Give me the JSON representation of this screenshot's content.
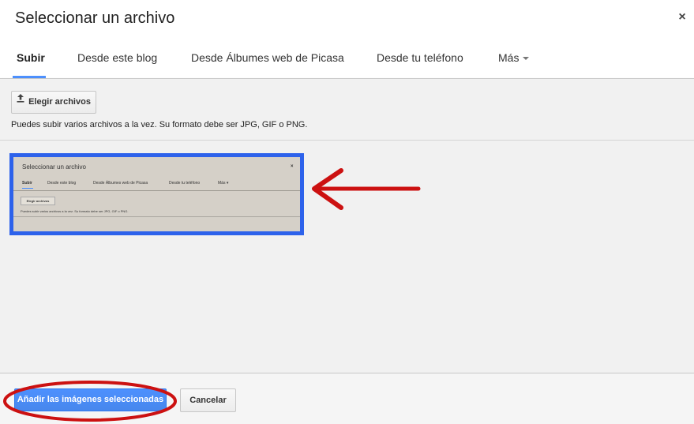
{
  "dialog": {
    "title": "Seleccionar un archivo",
    "close_glyph": "×"
  },
  "tabs": [
    {
      "label": "Subir",
      "active": true
    },
    {
      "label": "Desde este blog",
      "active": false
    },
    {
      "label": "Desde Álbumes web de Picasa",
      "active": false
    },
    {
      "label": "Desde tu teléfono",
      "active": false
    },
    {
      "label": "Más",
      "active": false,
      "icon": "caret-down-icon"
    }
  ],
  "upload": {
    "button_label": "Elegir archivos",
    "icon": "upload-icon",
    "hint": "Puedes subir varios archivos a la vez. Su formato debe ser JPG, GIF o PNG."
  },
  "selected_image": {
    "preview_title": "Seleccionar un archivo",
    "preview_close": "×",
    "preview_tabs": [
      "Subir",
      "Desde este blog",
      "Desde Álbumes web de Picasa",
      "Desde tu teléfono",
      "Más ▾"
    ],
    "preview_button": "Elegir archivos",
    "preview_hint": "Puedes subir varios archivos a la vez. Su formato debe ser JPG, GIF o PNG.",
    "selection_border_color": "#2d62eb"
  },
  "annotations": {
    "arrow_color": "#cc1111",
    "arrow_icon": "arrow-left-icon",
    "ellipse_color": "#cc1111"
  },
  "footer": {
    "primary_label": "Añadir las imágenes seleccionadas",
    "cancel_label": "Cancelar"
  },
  "colors": {
    "accent_blue": "#4d90fe",
    "body_gray": "#f1f1f1"
  }
}
